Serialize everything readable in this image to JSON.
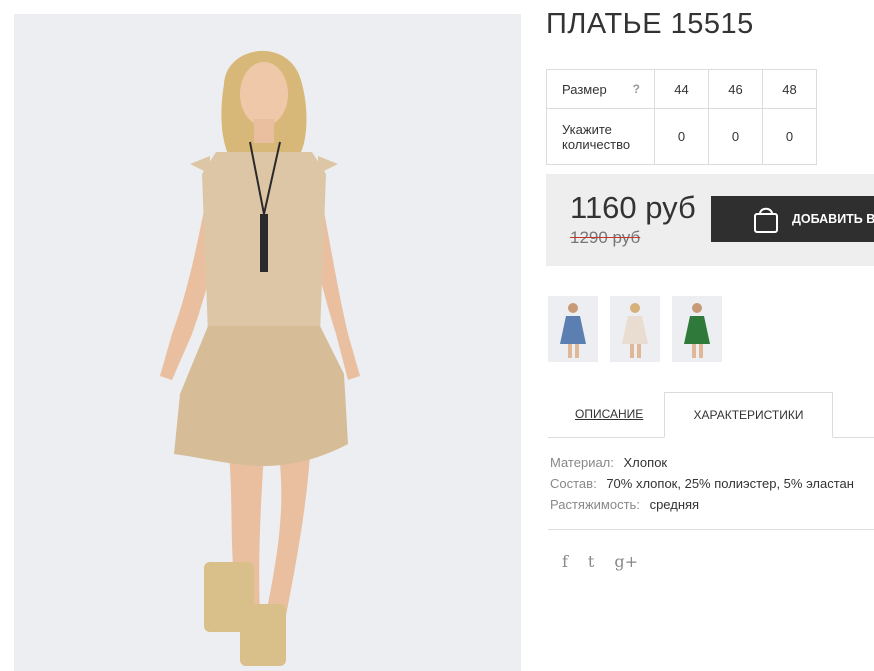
{
  "product": {
    "title": "ПЛАТЬЕ 15515"
  },
  "sizes": {
    "size_label": "Размер",
    "help_icon": "?",
    "qty_label": "Укажите количество",
    "items": [
      {
        "size": "44",
        "qty": "0"
      },
      {
        "size": "46",
        "qty": "0"
      },
      {
        "size": "48",
        "qty": "0"
      }
    ]
  },
  "price": {
    "current": "1160 руб",
    "old": "1290 руб",
    "add_button_label": "ДОБАВИТЬ В",
    "add_button_icon": "shopping-bag-icon"
  },
  "thumbnails": [
    {
      "name": "blue-dress",
      "color": "#5a7fb0"
    },
    {
      "name": "beige-dress",
      "color": "#e8ddd0"
    },
    {
      "name": "green-dress",
      "color": "#2f7a3a"
    }
  ],
  "tabs": {
    "description": "ОПИСАНИЕ",
    "characteristics": "ХАРАКТЕРИСТИКИ"
  },
  "characteristics": {
    "material_label": "Материал:",
    "material_value": "Хлопок",
    "composition_label": "Состав:",
    "composition_value": "70% хлопок, 25% полиэстер, 5% эластан",
    "stretch_label": "Растяжимость:",
    "stretch_value": "средняя"
  },
  "social": {
    "facebook": "f",
    "twitter": "t",
    "googleplus": "g+"
  },
  "colors": {
    "button_bg": "#2f2f2f",
    "price_box_bg": "#eeeeee",
    "dress": "#dcc6a6",
    "old_price_strike": "#c0392b"
  }
}
